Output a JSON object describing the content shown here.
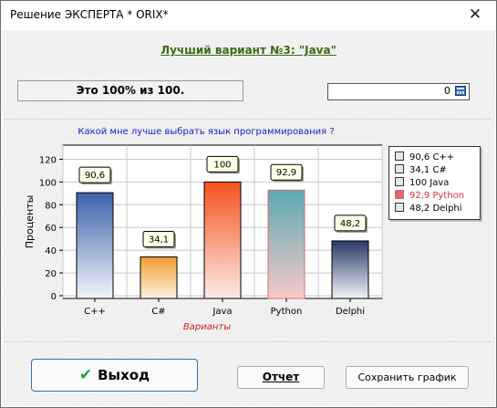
{
  "window": {
    "title": "Решение ЭКСПЕРТА * ORIX*",
    "close_glyph": "✕"
  },
  "heading": "Лучший вариант №3: \"Java\"",
  "result_text": "Это 100% из 100.",
  "number_field": {
    "value": "0",
    "icon": "calculator-icon"
  },
  "buttons": {
    "exit_label": "Выход",
    "exit_icon": "checkmark-icon",
    "report_label": "Отчет",
    "save_label": "Сохранить график"
  },
  "chart_data": {
    "type": "bar",
    "title": "Какой мне лучше выбрать язык программирования ?",
    "xlabel": "Варианты",
    "ylabel": "Проценты",
    "categories": [
      "C++",
      "C#",
      "Java",
      "Python",
      "Delphi"
    ],
    "values": [
      90.6,
      34.1,
      100,
      92.9,
      48.2
    ],
    "value_labels": [
      "90,6",
      "34,1",
      "100",
      "92,9",
      "48,2"
    ],
    "ylim": [
      0,
      130
    ],
    "yticks": [
      0,
      20,
      40,
      60,
      80,
      100,
      120
    ],
    "grid": true,
    "legend_position": "right",
    "legend": [
      "90,6 C++",
      "34,1 C#",
      "100 Java",
      "92,9 Python",
      "48,2 Delphi"
    ],
    "highlight_index": 3,
    "colors": {
      "title": "#1a1acd",
      "xlabel": "#cc2020",
      "legend_highlight": "#e03030",
      "bars": [
        {
          "top": "#3b62a8",
          "bottom": "#f2f5fb"
        },
        {
          "top": "#f19d2f",
          "bottom": "#fdf3e4"
        },
        {
          "top": "#f4521e",
          "bottom": "#fcebe6"
        },
        {
          "top": "#5aa9b1",
          "bottom": "#f6c9c9"
        },
        {
          "top": "#2a3a66",
          "bottom": "#f1f3f8"
        }
      ],
      "python_outline": "#e06a6a"
    }
  }
}
